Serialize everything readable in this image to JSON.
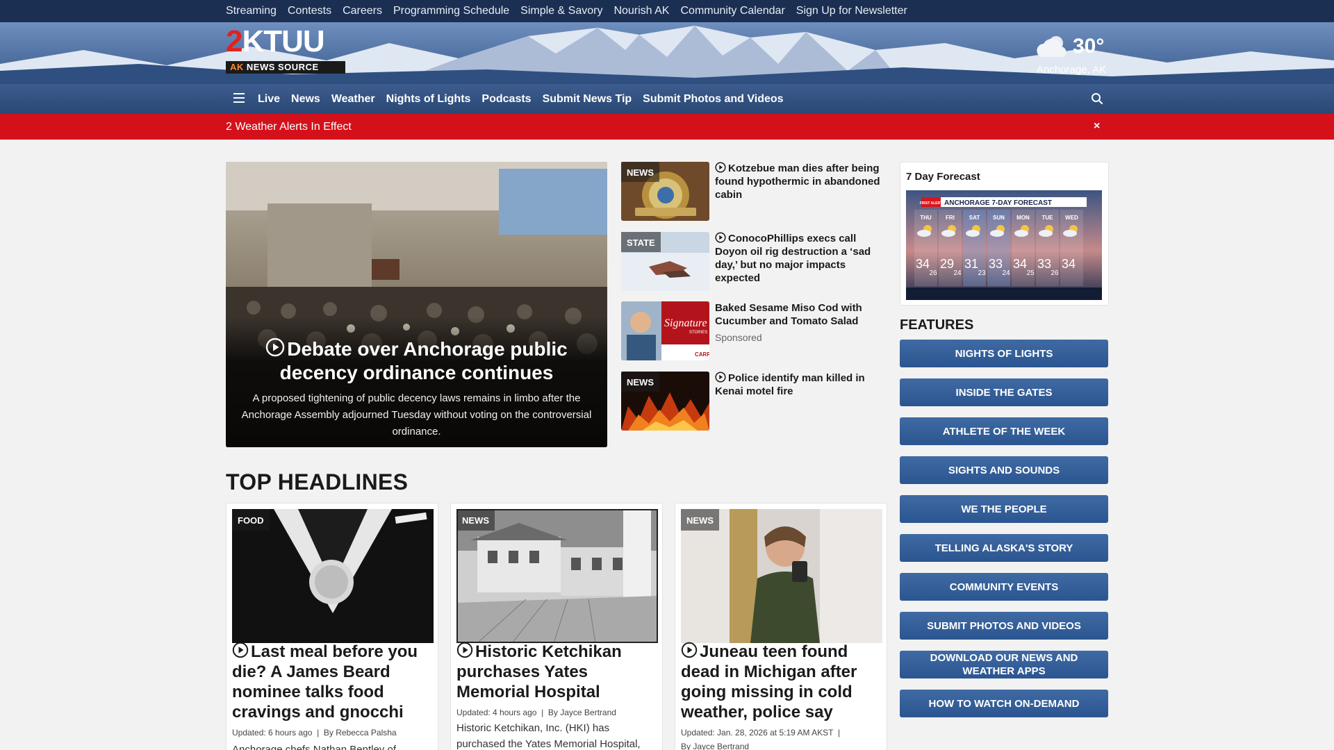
{
  "top_nav": [
    "Streaming",
    "Contests",
    "Careers",
    "Programming Schedule",
    "Simple & Savory",
    "Nourish AK",
    "Community Calendar",
    "Sign Up for Newsletter"
  ],
  "logo": {
    "mark_red": "2",
    "mark_white": "KTUU",
    "sub_ak": "AK",
    "sub_rest": " NEWS SOURCE"
  },
  "weather_now": {
    "temp": "30°",
    "location": "Anchorage, AK",
    "icon": "cloud-sun-icon"
  },
  "main_nav": [
    "Live",
    "News",
    "Weather",
    "Nights of Lights",
    "Podcasts",
    "Submit News Tip",
    "Submit Photos and Videos"
  ],
  "alert": {
    "text": "2 Weather Alerts In Effect",
    "close": "×"
  },
  "hero": {
    "title": "Debate over Anchorage public decency ordinance continues",
    "description": "A proposed tightening of public decency laws remains in limbo after the Anchorage Assembly adjourned Tuesday without voting on the controversial ordinance."
  },
  "side_stories": [
    {
      "tag": "NEWS",
      "headline": "Kotzebue man dies after being found hypothermic in abandoned cabin",
      "video": true
    },
    {
      "tag": "STATE",
      "headline": "ConocoPhillips execs call Doyon oil rig destruction a ‘sad day,’ but no major impacts expected",
      "video": true
    },
    {
      "tag": "",
      "headline": "Baked Sesame Miso Cod with Cucumber and Tomato Salad",
      "sponsored": "Sponsored",
      "video": false,
      "thumb_text": "Signature",
      "thumb_sub": "STORIES",
      "thumb_brand": "CARRS"
    },
    {
      "tag": "NEWS",
      "headline": "Police identify man killed in Kenai motel fire",
      "video": true
    }
  ],
  "forecast": {
    "title": "7 Day Forecast",
    "banner_badge": "FIRST ALERT",
    "banner": "ANCHORAGE 7-DAY FORECAST",
    "days": [
      {
        "day": "THU",
        "hi": "34",
        "lo": "26"
      },
      {
        "day": "FRI",
        "hi": "29",
        "lo": "24"
      },
      {
        "day": "SAT",
        "hi": "31",
        "lo": "23"
      },
      {
        "day": "SUN",
        "hi": "33",
        "lo": "24"
      },
      {
        "day": "MON",
        "hi": "34",
        "lo": "25"
      },
      {
        "day": "TUE",
        "hi": "33",
        "lo": "26"
      },
      {
        "day": "WED",
        "hi": "34",
        "lo": ""
      }
    ]
  },
  "features": {
    "heading": "FEATURES",
    "buttons": [
      "NIGHTS OF LIGHTS",
      "INSIDE THE GATES",
      "ATHLETE OF THE WEEK",
      "SIGHTS AND SOUNDS",
      "WE THE PEOPLE",
      "TELLING ALASKA'S STORY",
      "COMMUNITY EVENTS",
      "SUBMIT PHOTOS AND VIDEOS",
      "DOWNLOAD OUR NEWS AND WEATHER APPS",
      "HOW TO WATCH ON-DEMAND"
    ]
  },
  "top_headlines": {
    "heading": "TOP HEADLINES",
    "cards": [
      {
        "tag": "FOOD",
        "headline": "Last meal before you die? A James Beard nominee talks food cravings and gnocchi",
        "updated": "Updated: 6 hours ago",
        "byline": "By Rebecca Palsha",
        "snippet": "Anchorage chefs Nathan Bentley of"
      },
      {
        "tag": "NEWS",
        "headline": "Historic Ketchikan purchases Yates Memorial Hospital",
        "updated": "Updated: 4 hours ago",
        "byline": "By Jayce Bertrand",
        "snippet": "Historic Ketchikan, Inc. (HKI) has purchased the Yates Memorial Hospital,"
      },
      {
        "tag": "NEWS",
        "headline": "Juneau teen found dead in Michigan after going missing in cold weather, police say",
        "updated": "Updated: Jan. 28, 2026 at 5:19 AM AKST",
        "byline": "By Jayce Bertrand",
        "snippet": ""
      }
    ]
  }
}
